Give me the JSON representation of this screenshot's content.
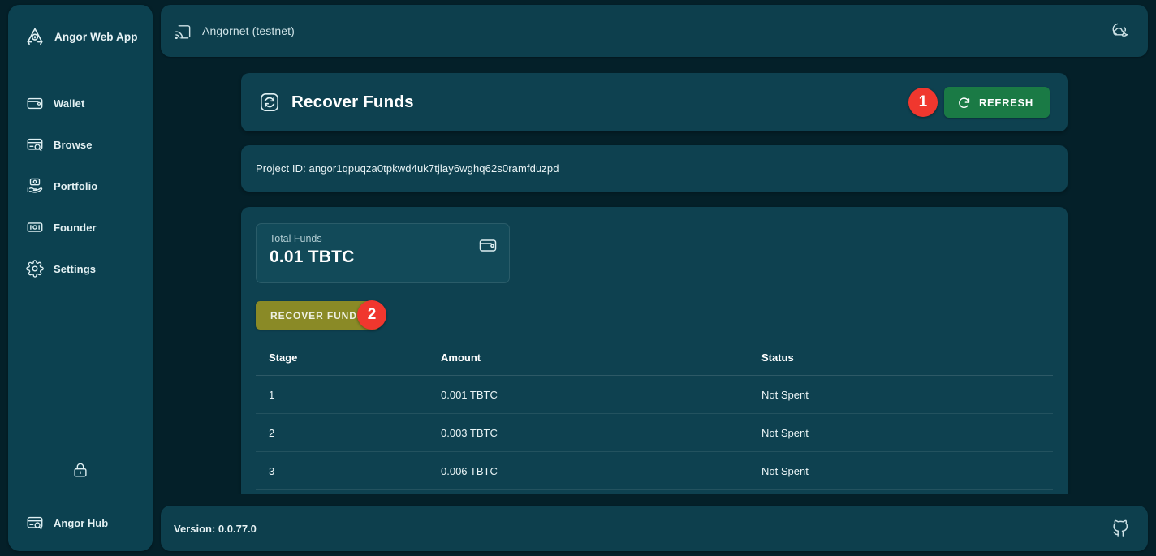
{
  "sidebar": {
    "brand": {
      "label": "Angor Web App",
      "icon": "angor-logo-icon"
    },
    "items": [
      {
        "label": "Wallet",
        "icon": "wallet-icon"
      },
      {
        "label": "Browse",
        "icon": "browse-card-search-icon"
      },
      {
        "label": "Portfolio",
        "icon": "portfolio-hand-coin-icon"
      },
      {
        "label": "Founder",
        "icon": "founder-banknote-icon"
      },
      {
        "label": "Settings",
        "icon": "gear-icon"
      }
    ],
    "lock_icon": "lock-icon",
    "hub": {
      "label": "Angor Hub",
      "icon": "hub-card-search-icon"
    }
  },
  "topbar": {
    "network_label": "Angornet (testnet)",
    "network_icon": "cast-connected-icon",
    "theme_icon": "moon-cloud-icon"
  },
  "page": {
    "title": "Recover Funds",
    "title_icon": "recover-refresh-icon",
    "refresh_label": "REFRESH",
    "refresh_icon": "refresh-circle-icon",
    "project_id_text": "Project ID: angor1qpuqza0tpkwd4uk7tjlay6wghq62s0ramfduzpd",
    "total_funds": {
      "label": "Total Funds",
      "value": "0.01 TBTC",
      "icon": "wallet-icon"
    },
    "recover_label": "RECOVER FUNDS",
    "table": {
      "columns": [
        "Stage",
        "Amount",
        "Status"
      ],
      "rows": [
        {
          "stage": "1",
          "amount": "0.001 TBTC",
          "status": "Not Spent"
        },
        {
          "stage": "2",
          "amount": "0.003 TBTC",
          "status": "Not Spent"
        },
        {
          "stage": "3",
          "amount": "0.006 TBTC",
          "status": "Not Spent"
        }
      ]
    }
  },
  "footer": {
    "version": "Version: 0.0.77.0",
    "github_icon": "github-icon"
  },
  "annotations": {
    "badge_one": "1",
    "badge_two": "2"
  },
  "colors": {
    "background": "#042029",
    "sidebar": "#0c4150",
    "panel": "#0e4150",
    "accent_green": "#1a7a45",
    "accent_olive": "#8a8a26",
    "status_green": "#4caf50",
    "badge_red": "#f0372e"
  }
}
